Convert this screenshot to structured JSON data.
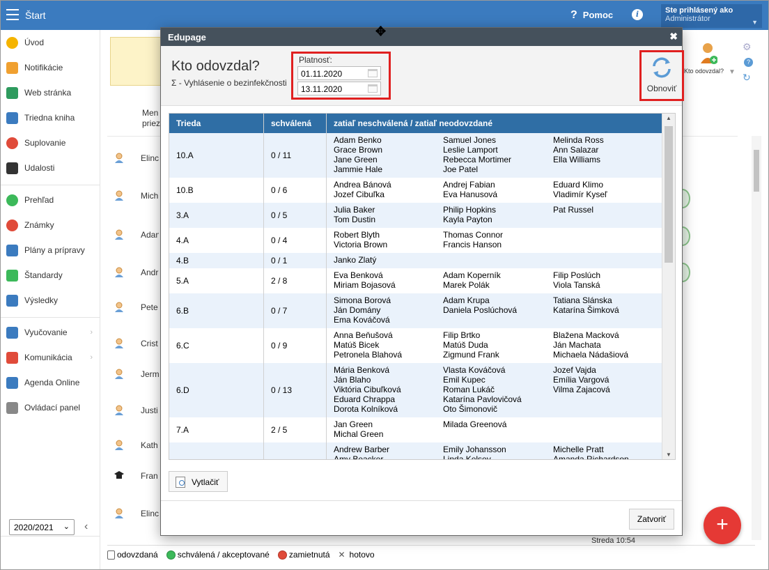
{
  "app": {
    "title": "Štart"
  },
  "topbar": {
    "help_label": "Pomoc",
    "user_label": "Ste prihlásený ako",
    "user_name": "Administrátor"
  },
  "sidebar": {
    "items": [
      {
        "label": "Úvod",
        "icon": "star-icon",
        "color": "#f5b400"
      },
      {
        "label": "Notifikácie",
        "icon": "envelope-icon",
        "color": "#f0a030"
      },
      {
        "label": "Web stránka",
        "icon": "home-icon",
        "color": "#2e9b5e"
      },
      {
        "label": "Triedna kniha",
        "icon": "book-icon",
        "color": "#3b7bbf"
      },
      {
        "label": "Suplovanie",
        "icon": "substitute-icon",
        "color": "#e04b3a"
      },
      {
        "label": "Udalosti",
        "icon": "calendar-icon",
        "color": "#333333"
      },
      {
        "label": "Prehľad",
        "icon": "check-circle-icon",
        "color": "#3cb95a"
      },
      {
        "label": "Známky",
        "icon": "grades-icon",
        "color": "#e04b3a"
      },
      {
        "label": "Plány a prípravy",
        "icon": "briefcase-icon",
        "color": "#3b7bbf"
      },
      {
        "label": "Štandardy",
        "icon": "shield-icon",
        "color": "#3cb95a"
      },
      {
        "label": "Výsledky",
        "icon": "bar-chart-icon",
        "color": "#3b7bbf"
      },
      {
        "label": "Vyučovanie",
        "icon": "teaching-icon",
        "color": "#3b7bbf"
      },
      {
        "label": "Komunikácia",
        "icon": "chat-icon",
        "color": "#e04b3a"
      },
      {
        "label": "Agenda Online",
        "icon": "pen-icon",
        "color": "#3b7bbf"
      },
      {
        "label": "Ovládací panel",
        "icon": "gear-icon",
        "color": "#888888"
      }
    ],
    "year": "2020/2021"
  },
  "background": {
    "header_text": [
      "Men",
      "priez"
    ],
    "rows": [
      "Elinc",
      "Mich Kone",
      "Adan",
      "Andr",
      "Pete",
      "Crist",
      "Jerm Bens",
      "Justi",
      "Kath",
      "Fran Školn",
      "Elinc"
    ],
    "kto_label": "Kto odovzdal?",
    "streda": "Streda 10:54"
  },
  "legend": [
    {
      "label": "odovzdaná"
    },
    {
      "label": "schválená / akceptované"
    },
    {
      "label": "zamietnutá"
    },
    {
      "label": "hotovo"
    }
  ],
  "dialog": {
    "title": "Edupage",
    "heading": "Kto odovzdal?",
    "subheading": "Σ - Vyhlásenie o bezinfekčnosti",
    "validity_label": "Platnosť:",
    "date_from": "01.11.2020",
    "date_to": "13.11.2020",
    "refresh_label": "Obnoviť",
    "print_label": "Vytlačiť",
    "close_label": "Zatvoriť",
    "columns": [
      "Trieda",
      "schválená",
      "zatiaľ neschválená / zatiaľ neodovzdané"
    ],
    "rows": [
      {
        "class": "10.A",
        "approved": "0 / 11",
        "names": [
          [
            "Adam Benko",
            "Grace Brown",
            "Jane Green",
            "Jammie Hale"
          ],
          [
            "Samuel Jones",
            "Leslie Lamport",
            "Rebecca Mortimer",
            "Joe Patel"
          ],
          [
            "Melinda Ross",
            "Ann Salazar",
            "Ella Williams"
          ]
        ]
      },
      {
        "class": "10.B",
        "approved": "0 / 6",
        "names": [
          [
            "Andrea Bánová",
            "Jozef Cibuľka"
          ],
          [
            "Andrej Fabian",
            "Eva Hanusová"
          ],
          [
            "Eduard Klimo",
            "Vladimír Kyseľ"
          ]
        ]
      },
      {
        "class": "3.A",
        "approved": "0 / 5",
        "names": [
          [
            "Julia Baker",
            "Tom Dustin"
          ],
          [
            "Philip Hopkins",
            "Kayla Payton"
          ],
          [
            "Pat Russel"
          ]
        ]
      },
      {
        "class": "4.A",
        "approved": "0 / 4",
        "names": [
          [
            "Robert Blyth",
            "Victoria Brown"
          ],
          [
            "Thomas Connor",
            "Francis Hanson"
          ],
          []
        ]
      },
      {
        "class": "4.B",
        "approved": "0 / 1",
        "names": [
          [
            "Janko Zlatý"
          ],
          [],
          []
        ]
      },
      {
        "class": "5.A",
        "approved": "2 / 8",
        "names": [
          [
            "Eva Benková",
            "Miriam Bojasová"
          ],
          [
            "Adam Koperník",
            "Marek Polák"
          ],
          [
            "Filip Poslúch",
            "Viola Tanská"
          ]
        ]
      },
      {
        "class": "6.B",
        "approved": "0 / 7",
        "names": [
          [
            "Simona Borová",
            "Ján Domány",
            "Ema Kováčová"
          ],
          [
            "Adam Krupa",
            "Daniela Poslúchová"
          ],
          [
            "Tatiana Slánska",
            "Katarína Šimková"
          ]
        ]
      },
      {
        "class": "6.C",
        "approved": "0 / 9",
        "names": [
          [
            "Anna Beňušová",
            "Matúš Bicek",
            "Petronela Blahová"
          ],
          [
            "Filip Brtko",
            "Matúš Duda",
            "Zigmund Frank"
          ],
          [
            "Blažena Macková",
            "Ján Machata",
            "Michaela Nádašiová"
          ]
        ]
      },
      {
        "class": "6.D",
        "approved": "0 / 13",
        "names": [
          [
            "Mária Benková",
            "Ján Blaho",
            "Viktória Cibuľková",
            "Eduard Chrappa",
            "Dorota Kolníková"
          ],
          [
            "Vlasta Kováčová",
            "Emil Kupec",
            "Roman Lukáč",
            "Katarína Pavlovičová",
            "Oto Šimonovič"
          ],
          [
            "Jozef Vajda",
            "Emília Vargová",
            "Vilma Zajacová"
          ]
        ]
      },
      {
        "class": "7.A",
        "approved": "2 / 5",
        "names": [
          [
            "Jan Green",
            "Michal Green"
          ],
          [
            "Milada Greenová"
          ],
          []
        ]
      },
      {
        "class": "",
        "approved": "",
        "names": [
          [
            "Andrew Barber",
            "Amy Beacker"
          ],
          [
            "Emily Johansson",
            "Linda Kelsey"
          ],
          [
            "Michelle Pratt",
            "Amanda Richardson"
          ]
        ]
      }
    ]
  }
}
